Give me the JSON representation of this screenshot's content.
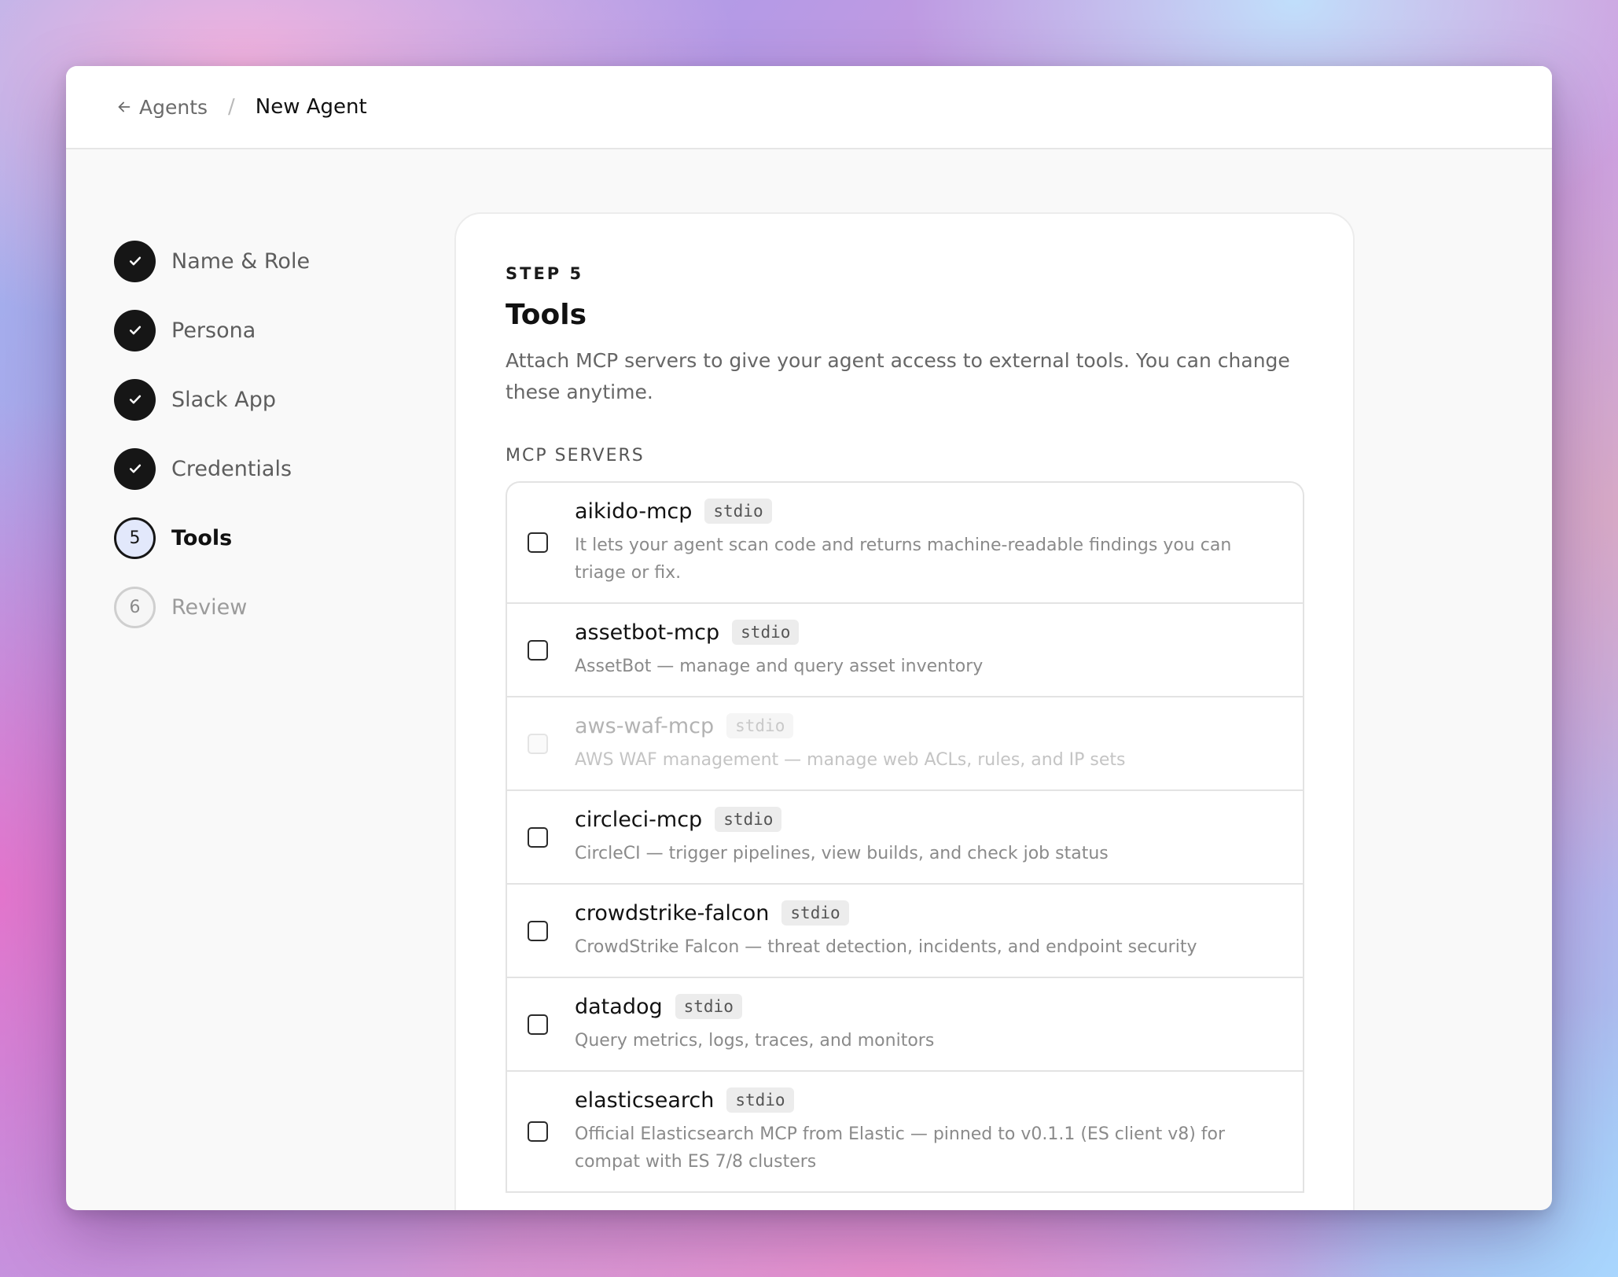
{
  "breadcrumb": {
    "back_label": "Agents",
    "separator": "/",
    "current": "New Agent"
  },
  "stepper": {
    "steps": [
      {
        "number": "1",
        "label": "Name & Role",
        "state": "done"
      },
      {
        "number": "2",
        "label": "Persona",
        "state": "done"
      },
      {
        "number": "3",
        "label": "Slack App",
        "state": "done"
      },
      {
        "number": "4",
        "label": "Credentials",
        "state": "done"
      },
      {
        "number": "5",
        "label": "Tools",
        "state": "current"
      },
      {
        "number": "6",
        "label": "Review",
        "state": "todo"
      }
    ]
  },
  "main": {
    "eyebrow": "STEP 5",
    "title": "Tools",
    "description": "Attach MCP servers to give your agent access to external tools. You can change these anytime.",
    "section_label": "MCP SERVERS",
    "servers": [
      {
        "name": "aikido-mcp",
        "transport": "stdio",
        "description": "It lets your agent scan code and returns machine-readable findings you can triage or fix.",
        "checked": false,
        "disabled": false
      },
      {
        "name": "assetbot-mcp",
        "transport": "stdio",
        "description": "AssetBot — manage and query asset inventory",
        "checked": false,
        "disabled": false
      },
      {
        "name": "aws-waf-mcp",
        "transport": "stdio",
        "description": "AWS WAF management — manage web ACLs, rules, and IP sets",
        "checked": false,
        "disabled": true
      },
      {
        "name": "circleci-mcp",
        "transport": "stdio",
        "description": "CircleCI — trigger pipelines, view builds, and check job status",
        "checked": false,
        "disabled": false
      },
      {
        "name": "crowdstrike-falcon",
        "transport": "stdio",
        "description": "CrowdStrike Falcon — threat detection, incidents, and endpoint security",
        "checked": false,
        "disabled": false
      },
      {
        "name": "datadog",
        "transport": "stdio",
        "description": "Query metrics, logs, traces, and monitors",
        "checked": false,
        "disabled": false
      },
      {
        "name": "elasticsearch",
        "transport": "stdio",
        "description": "Official Elasticsearch MCP from Elastic — pinned to v0.1.1 (ES client v8) for compat with ES 7/8 clusters",
        "checked": false,
        "disabled": false
      }
    ]
  },
  "icons": {
    "back": "arrow-left-icon",
    "done": "checkmark-icon"
  }
}
